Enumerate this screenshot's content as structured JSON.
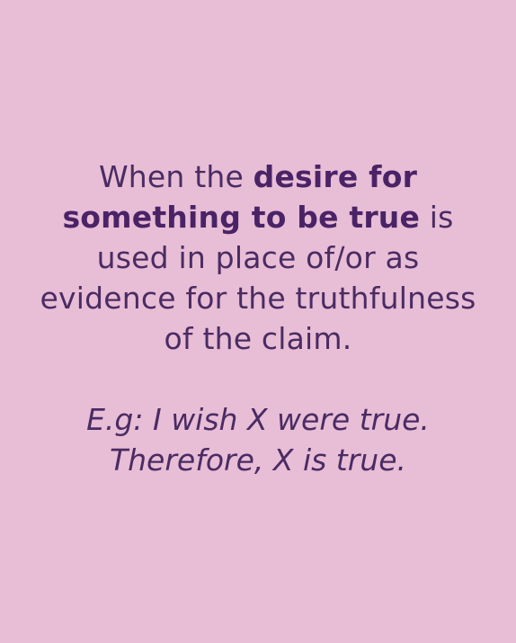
{
  "definition": {
    "part1": "When the ",
    "emphasis": "desire for something to be true",
    "part2": " is used in place of/or as evidence for the truthfulness of the claim."
  },
  "example": {
    "line1": "E.g: I wish X were true.",
    "line2": "Therefore, X is true."
  },
  "colors": {
    "background": "#e8bdd6",
    "text": "#4a2c63"
  }
}
